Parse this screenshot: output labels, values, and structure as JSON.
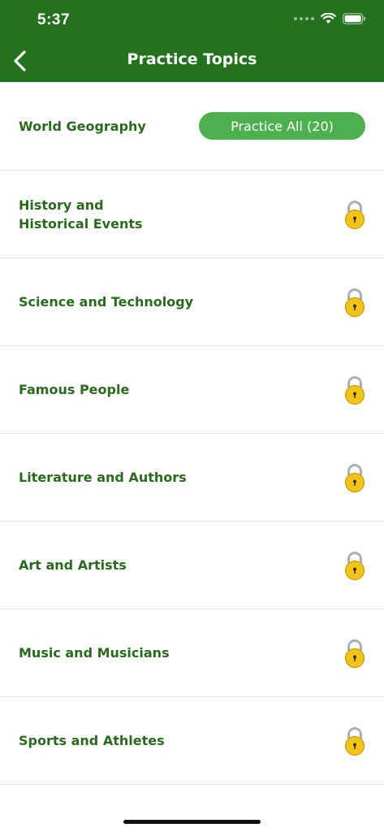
{
  "status_bar": {
    "time": "5:37"
  },
  "header": {
    "title": "Practice Topics",
    "back_icon": "chevron-left-icon",
    "background": "#24711f"
  },
  "practice_all": {
    "topic": "World Geography",
    "button_label": "Practice All (20)",
    "button_color": "#4cb04e"
  },
  "topics": [
    {
      "label": "History and\nHistorical Events",
      "locked": true
    },
    {
      "label": "Science and Technology",
      "locked": true
    },
    {
      "label": "Famous People",
      "locked": true
    },
    {
      "label": "Literature and Authors",
      "locked": true
    },
    {
      "label": "Art and Artists",
      "locked": true
    },
    {
      "label": "Music and Musicians",
      "locked": true
    },
    {
      "label": "Sports and Athletes",
      "locked": true
    }
  ],
  "colors": {
    "topic_text": "#2a6a1f",
    "lock": "#f0c419"
  }
}
